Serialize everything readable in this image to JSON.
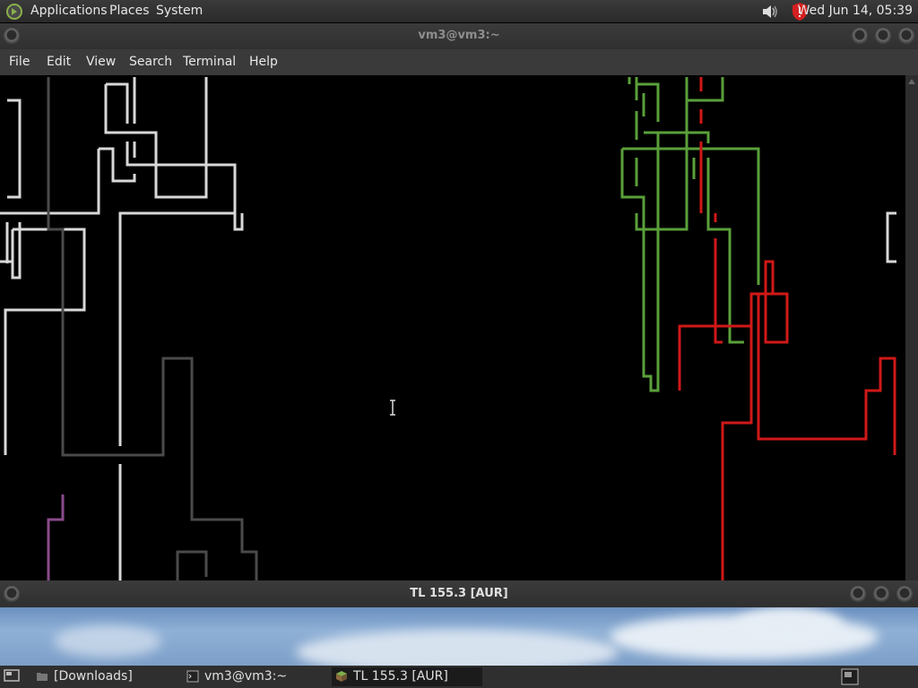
{
  "top_panel": {
    "menus": [
      "Applications",
      "Places",
      "System"
    ],
    "clock": "Wed Jun 14, 05:39",
    "icons": [
      "distro-logo-icon",
      "volume-icon",
      "shield-alert-icon"
    ]
  },
  "terminal": {
    "title": "vm3@vm3:~",
    "menu": [
      "File",
      "Edit",
      "View",
      "Search",
      "Terminal",
      "Help"
    ]
  },
  "second_window": {
    "title": "TL 155.3 [AUR]"
  },
  "taskbar": {
    "tasks": [
      {
        "label": "[Downloads]",
        "icon": "folder-icon"
      },
      {
        "label": "vm3@vm3:~",
        "icon": "terminal-icon"
      },
      {
        "label": "TL 155.3 [AUR]",
        "icon": "cube-icon",
        "active": true
      }
    ]
  },
  "colors": {
    "pipe_white": "#d8d8d8",
    "pipe_gray": "#4a4a4a",
    "pipe_green": "#5aa03a",
    "pipe_red": "#d01818",
    "pipe_purple": "#8a4a8a"
  }
}
